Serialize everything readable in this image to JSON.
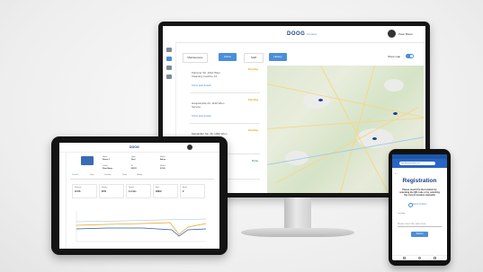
{
  "monitor": {
    "logo": "DOOG",
    "logo_sub": "inmotion",
    "user_name": "Peter Bauer",
    "tabs": [
      "Maintenance",
      "Active",
      "Staff",
      "History"
    ],
    "show_map_label": "Show map",
    "tasks": [
      {
        "status": "Pending",
        "line1": "Kärntner Str. 1010 Wien",
        "line2": "Cleaning machine 12",
        "link": "Show task details"
      },
      {
        "status": "Pending",
        "line1": "Hauptstraße 23, 1140 Wien",
        "line2": "Service",
        "link": "Show task details"
      },
      {
        "status": "Pending",
        "line1": "Mariahilfer Str. 45, 1060 Wien",
        "line2": "Inspection",
        "link": "Show task details"
      },
      {
        "status": "Done",
        "line1": "",
        "line2": "",
        "link": ""
      }
    ]
  },
  "tablet": {
    "logo": "DOOG",
    "fields": [
      {
        "k": "Name",
        "v": "Device 1"
      },
      {
        "k": "Type",
        "v": "Dust"
      },
      {
        "k": "Status",
        "v": "Active"
      },
      {
        "k": "Owner",
        "v": "Peter Bauer"
      },
      {
        "k": "ID",
        "v": "00123"
      },
      {
        "k": "Model",
        "v": "D-100"
      }
    ],
    "tabs": [
      "General",
      "Data",
      "Location",
      "Tasks",
      "History"
    ],
    "cards": [
      {
        "k": "Runtime",
        "v": "12.5h"
      },
      {
        "k": "Battery",
        "v": "87%"
      },
      {
        "k": "Speed",
        "v": "1.2 m/s"
      },
      {
        "k": "Area",
        "v": "340m²"
      },
      {
        "k": "Alerts",
        "v": "0"
      }
    ]
  },
  "phone": {
    "url": "app.doog-inmotion.com",
    "title": "Registration",
    "message": "Please insert the the location by scanning the QR code or by selecting the correct location manually",
    "link": "Select location",
    "label": "Location",
    "input_placeholder": "Please insert the name here",
    "button": "Submit"
  },
  "colors": {
    "accent": "#4a8fd8",
    "brand": "#1e3f8a"
  }
}
